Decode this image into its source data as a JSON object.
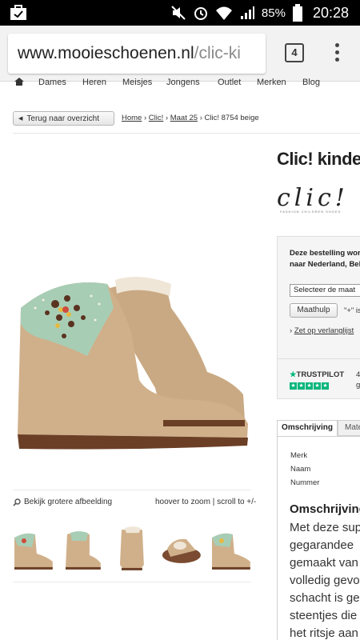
{
  "status_bar": {
    "battery_pct": "85%",
    "time": "20:28"
  },
  "browser": {
    "url_domain": "www.mooieschoenen.nl",
    "url_rest": "/clic-ki",
    "tab_count": "4"
  },
  "site_nav": [
    "Dames",
    "Heren",
    "Meisjes",
    "Jongens",
    "Outlet",
    "Merken",
    "Blog"
  ],
  "back_button": "Terug naar overzicht",
  "breadcrumb": {
    "home": "Home",
    "sep1": " › ",
    "brand": "Clic!",
    "sep2": " › ",
    "size": "Maat 25",
    "sep3": " › ",
    "current": "Clic! 8754 beige"
  },
  "product": {
    "title": "Clic! kinde",
    "brand_logo": "clic!",
    "brand_tagline": "FASHION CHILDREN SHOES"
  },
  "gallery": {
    "enlarge_label": "Bekijk grotere afbeelding",
    "zoom_hint": "hoover to zoom | scroll to +/-"
  },
  "order": {
    "line1": "Deze bestelling word",
    "line2": "naar Nederland, Bel",
    "size_select": "Selecteer de maat",
    "maathulp": "Maathulp",
    "plus_text": "\"+\" is",
    "wishlist_arrow": "›",
    "wishlist": "Zet op verlanglijst",
    "trustpilot": "TRUSTPILOT",
    "tp_score": "4",
    "tp_score2": "g"
  },
  "tabs": {
    "active": "Omschrijving",
    "other": "Mate"
  },
  "specs": [
    "Merk",
    "Naam",
    "Nummer"
  ],
  "description": {
    "title": "Omschrijving",
    "lines": [
      "Met deze sup",
      "gegarandee",
      "gemaakt van",
      "volledig gevo",
      "schacht is ge",
      "steentjes die",
      "het ritsje aan"
    ]
  },
  "colors": {
    "trustpilot_green": "#00b67a",
    "status_bar": "#000000"
  }
}
